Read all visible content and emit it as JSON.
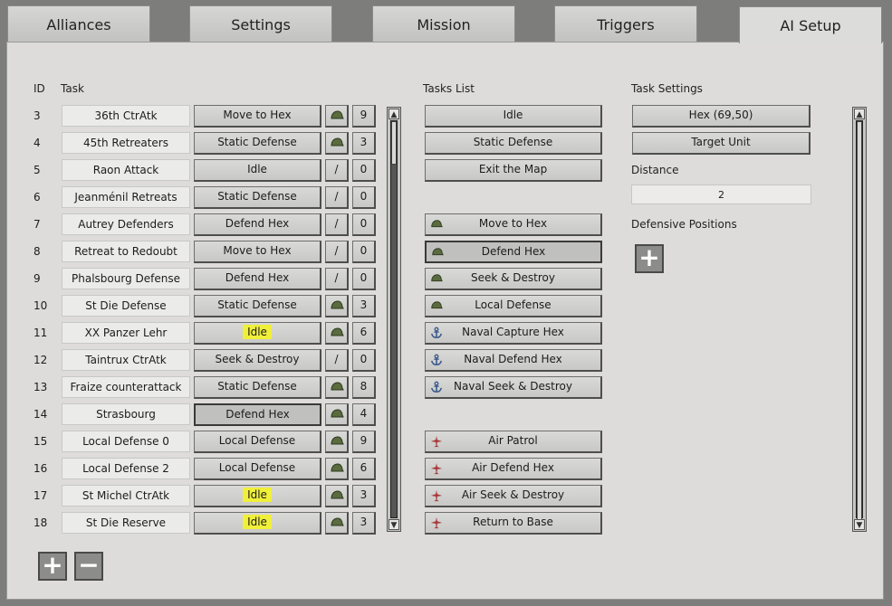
{
  "tabs": [
    {
      "label": "Alliances",
      "active": false
    },
    {
      "label": "Settings",
      "active": false
    },
    {
      "label": "Mission",
      "active": false
    },
    {
      "label": "Triggers",
      "active": false
    },
    {
      "label": "AI Setup",
      "active": true
    }
  ],
  "table": {
    "col_id": "ID",
    "col_task": "Task",
    "rows": [
      {
        "id": "3",
        "name": "36th CtrAtk",
        "type": "Move to Hex",
        "icon": "helmet",
        "count": "9"
      },
      {
        "id": "4",
        "name": "45th Retreaters",
        "type": "Static Defense",
        "icon": "helmet",
        "count": "3"
      },
      {
        "id": "5",
        "name": "Raon Attack",
        "type": "Idle",
        "icon": "slash",
        "count": "0"
      },
      {
        "id": "6",
        "name": "Jeanménil Retreats",
        "type": "Static Defense",
        "icon": "slash",
        "count": "0"
      },
      {
        "id": "7",
        "name": "Autrey Defenders",
        "type": "Defend Hex",
        "icon": "slash",
        "count": "0"
      },
      {
        "id": "8",
        "name": "Retreat to Redoubt",
        "type": "Move to Hex",
        "icon": "slash",
        "count": "0"
      },
      {
        "id": "9",
        "name": "Phalsbourg Defense",
        "type": "Defend Hex",
        "icon": "slash",
        "count": "0"
      },
      {
        "id": "10",
        "name": "St Die Defense",
        "type": "Static Defense",
        "icon": "helmet",
        "count": "3"
      },
      {
        "id": "11",
        "name": "XX Panzer Lehr",
        "type": "Idle",
        "icon": "helmet",
        "count": "6",
        "highlight": true
      },
      {
        "id": "12",
        "name": "Taintrux CtrAtk",
        "type": "Seek & Destroy",
        "icon": "slash",
        "count": "0"
      },
      {
        "id": "13",
        "name": "Fraize counterattack",
        "type": "Static Defense",
        "icon": "helmet",
        "count": "8"
      },
      {
        "id": "14",
        "name": "Strasbourg",
        "type": "Defend Hex",
        "icon": "helmet",
        "count": "4",
        "selected": true
      },
      {
        "id": "15",
        "name": "Local Defense 0",
        "type": "Local Defense",
        "icon": "helmet",
        "count": "9"
      },
      {
        "id": "16",
        "name": "Local Defense 2",
        "type": "Local Defense",
        "icon": "helmet",
        "count": "6"
      },
      {
        "id": "17",
        "name": "St Michel CtrAtk",
        "type": "Idle",
        "icon": "helmet",
        "count": "3",
        "highlight": true
      },
      {
        "id": "18",
        "name": "St Die Reserve",
        "type": "Idle",
        "icon": "helmet",
        "count": "3",
        "highlight": true
      }
    ],
    "slash_glyph": "/"
  },
  "tasks_list": {
    "header": "Tasks List",
    "general": [
      {
        "label": "Idle"
      },
      {
        "label": "Static Defense"
      },
      {
        "label": "Exit the Map"
      }
    ],
    "land": [
      {
        "label": "Move to Hex",
        "icon": "helmet-icon"
      },
      {
        "label": "Defend Hex",
        "icon": "helmet-icon",
        "selected": true
      },
      {
        "label": "Seek & Destroy",
        "icon": "helmet-icon"
      },
      {
        "label": "Local Defense",
        "icon": "helmet-icon"
      }
    ],
    "naval": [
      {
        "label": "Naval Capture Hex",
        "icon": "anchor-icon"
      },
      {
        "label": "Naval Defend Hex",
        "icon": "anchor-icon"
      },
      {
        "label": "Naval Seek & Destroy",
        "icon": "anchor-icon"
      }
    ],
    "air": [
      {
        "label": "Air Patrol",
        "icon": "plane-icon"
      },
      {
        "label": "Air Defend Hex",
        "icon": "plane-icon"
      },
      {
        "label": "Air Seek & Destroy",
        "icon": "plane-icon"
      },
      {
        "label": "Return to Base",
        "icon": "plane-icon"
      }
    ]
  },
  "task_settings": {
    "header": "Task Settings",
    "hex_button": "Hex (69,50)",
    "target_button": "Target Unit",
    "distance_label": "Distance",
    "distance_value": "2",
    "defensive_label": "Defensive Positions"
  },
  "colors": {
    "highlight": "#f0ef3a",
    "helmet": "#5a6b3e",
    "anchor": "#3b5a8c",
    "plane": "#a83a3a"
  }
}
